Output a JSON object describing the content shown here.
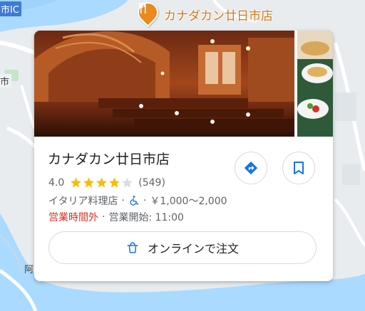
{
  "map": {
    "label_top_left": "市IC",
    "label_left_mid": "市",
    "label_bottom": "阿",
    "colors": {
      "water": "#aadaff",
      "land": "#e8ecef",
      "road": "#ffffff",
      "park": "#c6e6c8"
    }
  },
  "marker": {
    "label": "カナダカン廿日市店",
    "icon": "fork-knife-icon",
    "color": "#ea8a1e"
  },
  "place": {
    "name": "カナダカン廿日市店",
    "rating": "4.0",
    "stars": 4,
    "review_count": "(549)",
    "category": "イタリア料理店",
    "separator": "·",
    "accessibility_icon": "wheelchair-icon",
    "price_range": "￥1,000～2,000",
    "hours_status": "営業時間外",
    "hours_next": "営業開始: 11:00",
    "photos": [
      "restaurant-interior-photo",
      "food-dishes-photo"
    ]
  },
  "actions": {
    "directions_icon": "directions-icon",
    "save_icon": "bookmark-icon",
    "order_label": "オンラインで注文",
    "order_icon": "shopping-bag-icon"
  },
  "colors": {
    "accent": "#1a73e8",
    "closed": "#d93025",
    "star": "#fbbc04"
  }
}
